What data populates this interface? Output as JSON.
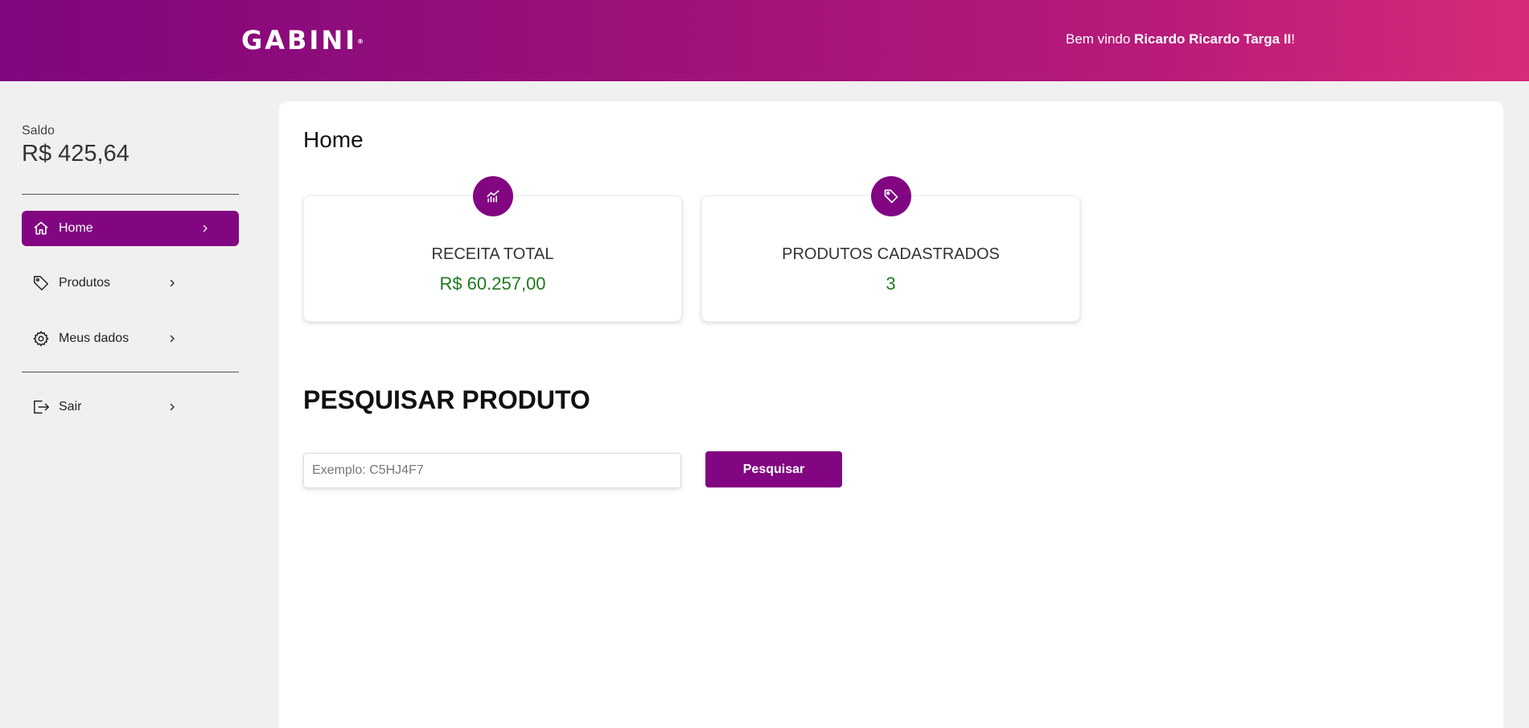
{
  "header": {
    "logo": "GABINI",
    "logo_mark": "®",
    "welcome_prefix": "Bem vindo ",
    "user_name": "Ricardo Ricardo Targa II",
    "welcome_suffix": "!"
  },
  "sidebar": {
    "balance_label": "Saldo",
    "balance_value": "R$ 425,64",
    "items": [
      {
        "label": "Home",
        "icon": "home-icon",
        "active": true
      },
      {
        "label": "Produtos",
        "icon": "tag-icon",
        "active": false
      },
      {
        "label": "Meus dados",
        "icon": "gear-icon",
        "active": false
      },
      {
        "label": "Sair",
        "icon": "logout-icon",
        "active": false
      }
    ]
  },
  "main": {
    "title": "Home",
    "cards": [
      {
        "title": "RECEITA TOTAL",
        "value": "R$ 60.257,00",
        "icon": "chart-icon"
      },
      {
        "title": "PRODUTOS CADASTRADOS",
        "value": "3",
        "icon": "tag-icon"
      }
    ],
    "search": {
      "heading": "PESQUISAR PRODUTO",
      "placeholder": "Exemplo: C5HJ4F7",
      "value": "",
      "button_label": "Pesquisar"
    }
  },
  "colors": {
    "brand": "#820582",
    "gradient_start": "#80057f",
    "gradient_end": "#d62b78",
    "value_green": "#1f7a1f"
  }
}
